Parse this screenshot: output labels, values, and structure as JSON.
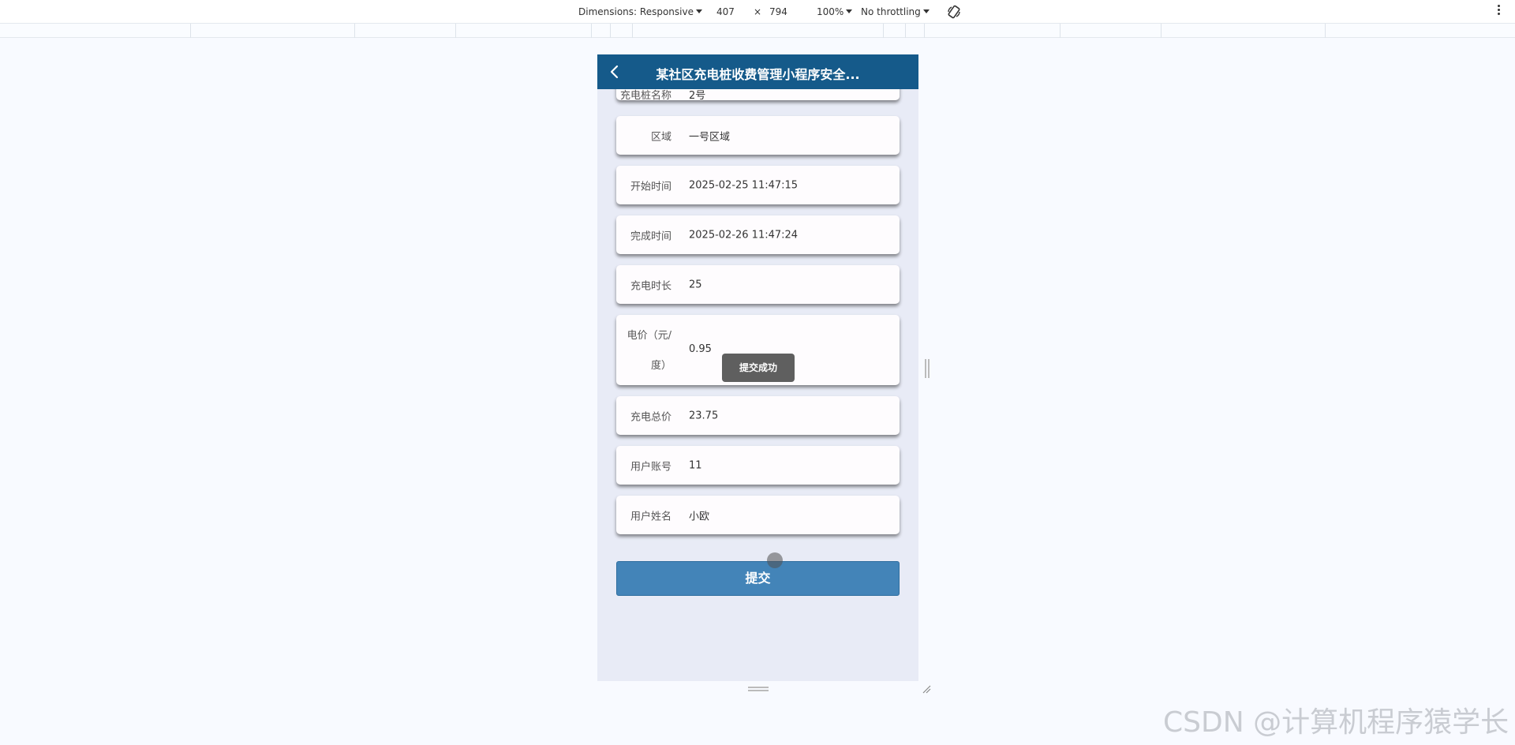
{
  "devtools": {
    "dimensions_label": "Dimensions: Responsive",
    "width": "407",
    "times": "×",
    "height": "794",
    "zoom": "100%",
    "throttling": "No throttling"
  },
  "app": {
    "title": "某社区充电桩收费管理小程序安全...",
    "partial_row": {
      "label": "充电桩名称",
      "value": "2号"
    },
    "fields": [
      {
        "label": "区域",
        "value": "一号区域"
      },
      {
        "label": "开始时间",
        "value": "2025-02-25 11:47:15"
      },
      {
        "label": "完成时间",
        "value": "2025-02-26 11:47:24"
      },
      {
        "label": "充电时长",
        "value": "25"
      },
      {
        "label": "电价（元/度）",
        "value": "0.95"
      },
      {
        "label": "充电总价",
        "value": "23.75"
      },
      {
        "label": "用户账号",
        "value": "11"
      },
      {
        "label": "用户姓名",
        "value": "小欧"
      }
    ],
    "toast": "提交成功",
    "submit_label": "提交"
  },
  "watermark": "CSDN @计算机程序猿学长"
}
